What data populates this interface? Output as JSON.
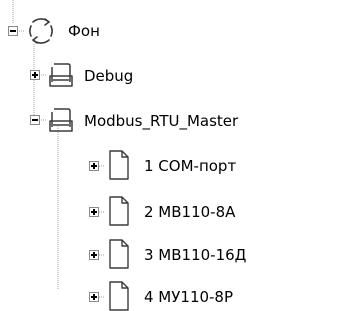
{
  "tree": {
    "root": {
      "label": "Фон",
      "icon": "refresh-cycle-icon",
      "expanded": true
    },
    "children": [
      {
        "label": "Debug",
        "icon": "folder-tray-icon",
        "expanded": false
      },
      {
        "label": "Modbus_RTU_Master",
        "icon": "folder-tray-icon",
        "expanded": true,
        "children": [
          {
            "label": "1 COM-порт",
            "icon": "document-icon",
            "expanded": false
          },
          {
            "label": "2 МВ110-8А",
            "icon": "document-icon",
            "expanded": false
          },
          {
            "label": "3 МВ110-16Д",
            "icon": "document-icon",
            "expanded": false
          },
          {
            "label": "4 МУ110-8Р",
            "icon": "document-icon",
            "expanded": false
          }
        ]
      }
    ]
  },
  "colors": {
    "guide_lines": "#a0a0a0",
    "toggle_border": "#8a8a8a",
    "icon_stroke": "#3c3c3c",
    "text": "#000000"
  }
}
